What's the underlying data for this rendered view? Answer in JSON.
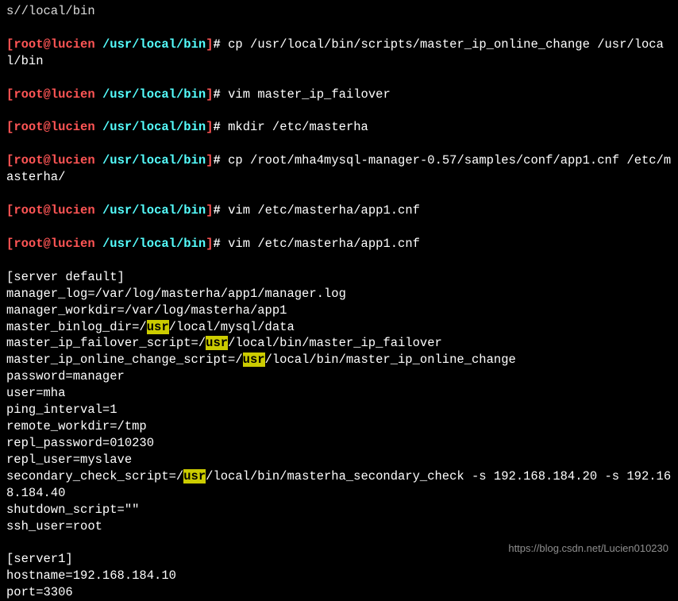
{
  "cutline": "s//local/bin",
  "prompt": {
    "lbracket": "[",
    "user": "root",
    "at": "@",
    "host": "lucien",
    "space": " ",
    "cwd": "/usr/local/bin",
    "rbracket": "]",
    "hash": "# "
  },
  "cmds": {
    "c1": "cp /usr/local/bin/scripts/master_ip_online_change /usr/local/bin",
    "c2": "vim master_ip_failover",
    "c3": "mkdir /etc/masterha",
    "c4": "cp /root/mha4mysql-manager-0.57/samples/conf/app1.cnf /etc/masterha/",
    "c5": "vim /etc/masterha/app1.cnf",
    "c6": "vim /etc/masterha/app1.cnf"
  },
  "hl": "usr",
  "file": {
    "sec_default": "[server default]",
    "manager_log": "manager_log=/var/log/masterha/app1/manager.log",
    "manager_workdir": "manager_workdir=/var/log/masterha/app1",
    "binlog_pre": "master_binlog_dir=/",
    "binlog_post": "/local/mysql/data",
    "failover_pre": "master_ip_failover_script=/",
    "failover_post": "/local/bin/master_ip_failover",
    "online_pre": "master_ip_online_change_script=/",
    "online_post": "/local/bin/master_ip_online_change",
    "password": "password=manager",
    "user": "user=mha",
    "ping": "ping_interval=1",
    "remote": "remote_workdir=/tmp",
    "repl_pw": "repl_password=010230",
    "repl_user": "repl_user=myslave",
    "sec_check_pre": "secondary_check_script=/",
    "sec_check_post": "/local/bin/masterha_secondary_check -s 192.168.184.20 -s 192.168.184.40",
    "shutdown": "shutdown_script=\"\"",
    "ssh": "ssh_user=root",
    "sec_s1": "[server1]",
    "hostname": "hostname=192.168.184.10",
    "port": "port=3306"
  },
  "watermark": "https://blog.csdn.net/Lucien010230"
}
